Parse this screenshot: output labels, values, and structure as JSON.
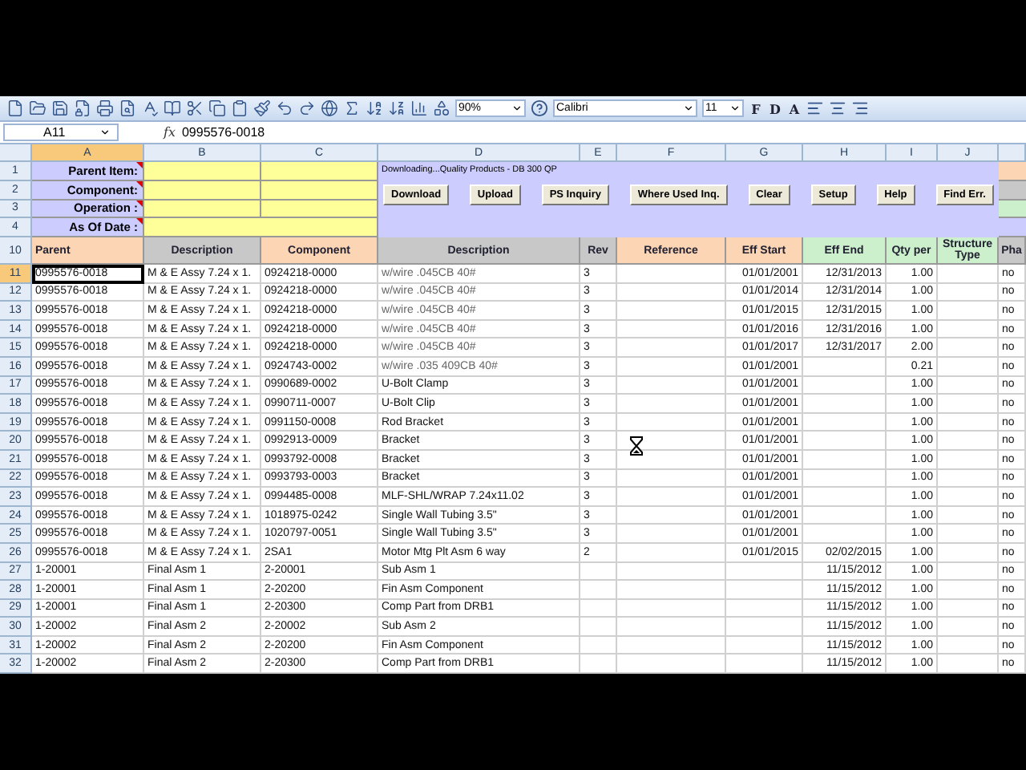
{
  "toolbar": {
    "zoom": "90%",
    "font": "Calibri",
    "font_size": "11",
    "style_buttons": [
      "F",
      "D",
      "A"
    ]
  },
  "formula_bar": {
    "name_box": "A11",
    "fx": "fx",
    "value": "0995576-0018"
  },
  "columns": [
    {
      "letter": "A",
      "selected": true
    },
    {
      "letter": "B",
      "selected": false
    },
    {
      "letter": "C",
      "selected": false
    },
    {
      "letter": "D",
      "selected": false
    },
    {
      "letter": "E",
      "selected": false
    },
    {
      "letter": "F",
      "selected": false
    },
    {
      "letter": "G",
      "selected": false
    },
    {
      "letter": "H",
      "selected": false
    },
    {
      "letter": "I",
      "selected": false
    },
    {
      "letter": "J",
      "selected": false
    }
  ],
  "parameters": [
    {
      "row": "1",
      "label": "Parent Item:"
    },
    {
      "row": "2",
      "label": "Component:"
    },
    {
      "row": "3",
      "label": "Operation :"
    },
    {
      "row": "4",
      "label": "As Of Date :"
    }
  ],
  "status_text": "Downloading...Quality Products - DB 300 QP",
  "buttons": [
    "Download",
    "Upload",
    "PS Inquiry",
    "Where Used Inq.",
    "Clear",
    "Setup",
    "Help",
    "Find Err."
  ],
  "legend": [
    {
      "color": "#fcd5b4"
    },
    {
      "color": "#c8c8c8"
    },
    {
      "color": "#ccf0cc"
    },
    {
      "color": "#ccccff"
    }
  ],
  "header_row": {
    "row": "10",
    "cells": [
      {
        "label": "Parent",
        "color": "#fcd5b4"
      },
      {
        "label": "Description",
        "color": "#c8c8c8"
      },
      {
        "label": "Component",
        "color": "#fcd5b4"
      },
      {
        "label": "Description",
        "color": "#c8c8c8"
      },
      {
        "label": "Rev",
        "color": "#c8c8c8"
      },
      {
        "label": "Reference",
        "color": "#fcd5b4"
      },
      {
        "label": "Eff Start",
        "color": "#fcd5b4"
      },
      {
        "label": "Eff End",
        "color": "#ccf0cc"
      },
      {
        "label": "Qty per",
        "color": "#ccf0cc"
      },
      {
        "label": "Structure Type",
        "color": "#ccf0cc"
      },
      {
        "label": "Pha",
        "color": "#c8c8c8"
      }
    ]
  },
  "rows": [
    {
      "row": "11",
      "selected": true,
      "parent": "0995576-0018",
      "description": "M & E Assy 7.24 x 1.",
      "component": "0924218-0000",
      "component_description": "w/wire .045CB 40#",
      "rev": "3",
      "eff_start": "01/01/2001",
      "eff_end": "12/31/2013",
      "qty_per": "1.00",
      "phantom": "no"
    },
    {
      "row": "12",
      "selected": false,
      "parent": "0995576-0018",
      "description": "M & E Assy 7.24 x 1.",
      "component": "0924218-0000",
      "component_description": "w/wire .045CB 40#",
      "rev": "3",
      "eff_start": "01/01/2014",
      "eff_end": "12/31/2014",
      "qty_per": "1.00",
      "phantom": "no"
    },
    {
      "row": "13",
      "selected": false,
      "parent": "0995576-0018",
      "description": "M & E Assy 7.24 x 1.",
      "component": "0924218-0000",
      "component_description": "w/wire .045CB 40#",
      "rev": "3",
      "eff_start": "01/01/2015",
      "eff_end": "12/31/2015",
      "qty_per": "1.00",
      "phantom": "no"
    },
    {
      "row": "14",
      "selected": false,
      "parent": "0995576-0018",
      "description": "M & E Assy 7.24 x 1.",
      "component": "0924218-0000",
      "component_description": "w/wire .045CB 40#",
      "rev": "3",
      "eff_start": "01/01/2016",
      "eff_end": "12/31/2016",
      "qty_per": "1.00",
      "phantom": "no"
    },
    {
      "row": "15",
      "selected": false,
      "parent": "0995576-0018",
      "description": "M & E Assy 7.24 x 1.",
      "component": "0924218-0000",
      "component_description": "w/wire .045CB 40#",
      "rev": "3",
      "eff_start": "01/01/2017",
      "eff_end": "12/31/2017",
      "qty_per": "2.00",
      "phantom": "no"
    },
    {
      "row": "16",
      "selected": false,
      "parent": "0995576-0018",
      "description": "M & E Assy 7.24 x 1.",
      "component": "0924743-0002",
      "component_description": "w/wire .035 409CB 40#",
      "rev": "3",
      "eff_start": "01/01/2001",
      "qty_per": "0.21",
      "phantom": "no"
    },
    {
      "row": "17",
      "selected": false,
      "parent": "0995576-0018",
      "description": "M & E Assy 7.24 x 1.",
      "component": "0990689-0002",
      "component_description": "U-Bolt Clamp",
      "rev": "3",
      "eff_start": "01/01/2001",
      "qty_per": "1.00",
      "phantom": "no"
    },
    {
      "row": "18",
      "selected": false,
      "parent": "0995576-0018",
      "description": "M & E Assy 7.24 x 1.",
      "component": "0990711-0007",
      "component_description": "U-Bolt Clip",
      "rev": "3",
      "eff_start": "01/01/2001",
      "qty_per": "1.00",
      "phantom": "no"
    },
    {
      "row": "19",
      "selected": false,
      "parent": "0995576-0018",
      "description": "M & E Assy 7.24 x 1.",
      "component": "0991150-0008",
      "component_description": "Rod Bracket",
      "rev": "3",
      "eff_start": "01/01/2001",
      "qty_per": "1.00",
      "phantom": "no"
    },
    {
      "row": "20",
      "selected": false,
      "parent": "0995576-0018",
      "description": "M & E Assy 7.24 x 1.",
      "component": "0992913-0009",
      "component_description": "Bracket",
      "rev": "3",
      "eff_start": "01/01/2001",
      "qty_per": "1.00",
      "phantom": "no"
    },
    {
      "row": "21",
      "selected": false,
      "parent": "0995576-0018",
      "description": "M & E Assy 7.24 x 1.",
      "component": "0993792-0008",
      "component_description": "Bracket",
      "rev": "3",
      "eff_start": "01/01/2001",
      "qty_per": "1.00",
      "phantom": "no"
    },
    {
      "row": "22",
      "selected": false,
      "parent": "0995576-0018",
      "description": "M & E Assy 7.24 x 1.",
      "component": "0993793-0003",
      "component_description": "Bracket",
      "rev": "3",
      "eff_start": "01/01/2001",
      "qty_per": "1.00",
      "phantom": "no"
    },
    {
      "row": "23",
      "selected": false,
      "parent": "0995576-0018",
      "description": "M & E Assy 7.24 x 1.",
      "component": "0994485-0008",
      "component_description": "MLF-SHL/WRAP 7.24x11.02",
      "rev": "3",
      "eff_start": "01/01/2001",
      "qty_per": "1.00",
      "phantom": "no"
    },
    {
      "row": "24",
      "selected": false,
      "parent": "0995576-0018",
      "description": "M & E Assy 7.24 x 1.",
      "component": "1018975-0242",
      "component_description": "Single Wall Tubing 3.5\"",
      "rev": "3",
      "eff_start": "01/01/2001",
      "qty_per": "1.00",
      "phantom": "no"
    },
    {
      "row": "25",
      "selected": false,
      "parent": "0995576-0018",
      "description": "M & E Assy 7.24 x 1.",
      "component": "1020797-0051",
      "component_description": "Single Wall Tubing 3.5\"",
      "rev": "3",
      "eff_start": "01/01/2001",
      "qty_per": "1.00",
      "phantom": "no"
    },
    {
      "row": "26",
      "selected": false,
      "parent": "0995576-0018",
      "description": "M & E Assy 7.24 x 1.",
      "component": "2SA1",
      "component_description": "Motor Mtg Plt Asm 6 way",
      "rev": "2",
      "eff_start": "01/01/2015",
      "eff_end": "02/02/2015",
      "qty_per": "1.00",
      "phantom": "no"
    },
    {
      "row": "27",
      "selected": false,
      "parent": "1-20001",
      "description": "Final Asm 1",
      "component": "2-20001",
      "component_description": "Sub Asm 1",
      "eff_end": "11/15/2012",
      "qty_per": "1.00",
      "phantom": "no"
    },
    {
      "row": "28",
      "selected": false,
      "parent": "1-20001",
      "description": "Final Asm 1",
      "component": "2-20200",
      "component_description": "Fin Asm Component",
      "eff_end": "11/15/2012",
      "qty_per": "1.00",
      "phantom": "no"
    },
    {
      "row": "29",
      "selected": false,
      "parent": "1-20001",
      "description": "Final Asm 1",
      "component": "2-20300",
      "component_description": "Comp Part from DRB1",
      "eff_end": "11/15/2012",
      "qty_per": "1.00",
      "phantom": "no"
    },
    {
      "row": "30",
      "selected": false,
      "parent": "1-20002",
      "description": "Final Asm 2",
      "component": "2-20002",
      "component_description": "Sub Asm 2",
      "eff_end": "11/15/2012",
      "qty_per": "1.00",
      "phantom": "no"
    },
    {
      "row": "31",
      "selected": false,
      "parent": "1-20002",
      "description": "Final Asm 2",
      "component": "2-20200",
      "component_description": "Fin Asm Component",
      "eff_end": "11/15/2012",
      "qty_per": "1.00",
      "phantom": "no"
    },
    {
      "row": "32",
      "selected": false,
      "parent": "1-20002",
      "description": "Final Asm 2",
      "component": "2-20300",
      "component_description": "Comp Part from DRB1",
      "eff_end": "11/15/2012",
      "qty_per": "1.00",
      "phantom": "no"
    }
  ]
}
